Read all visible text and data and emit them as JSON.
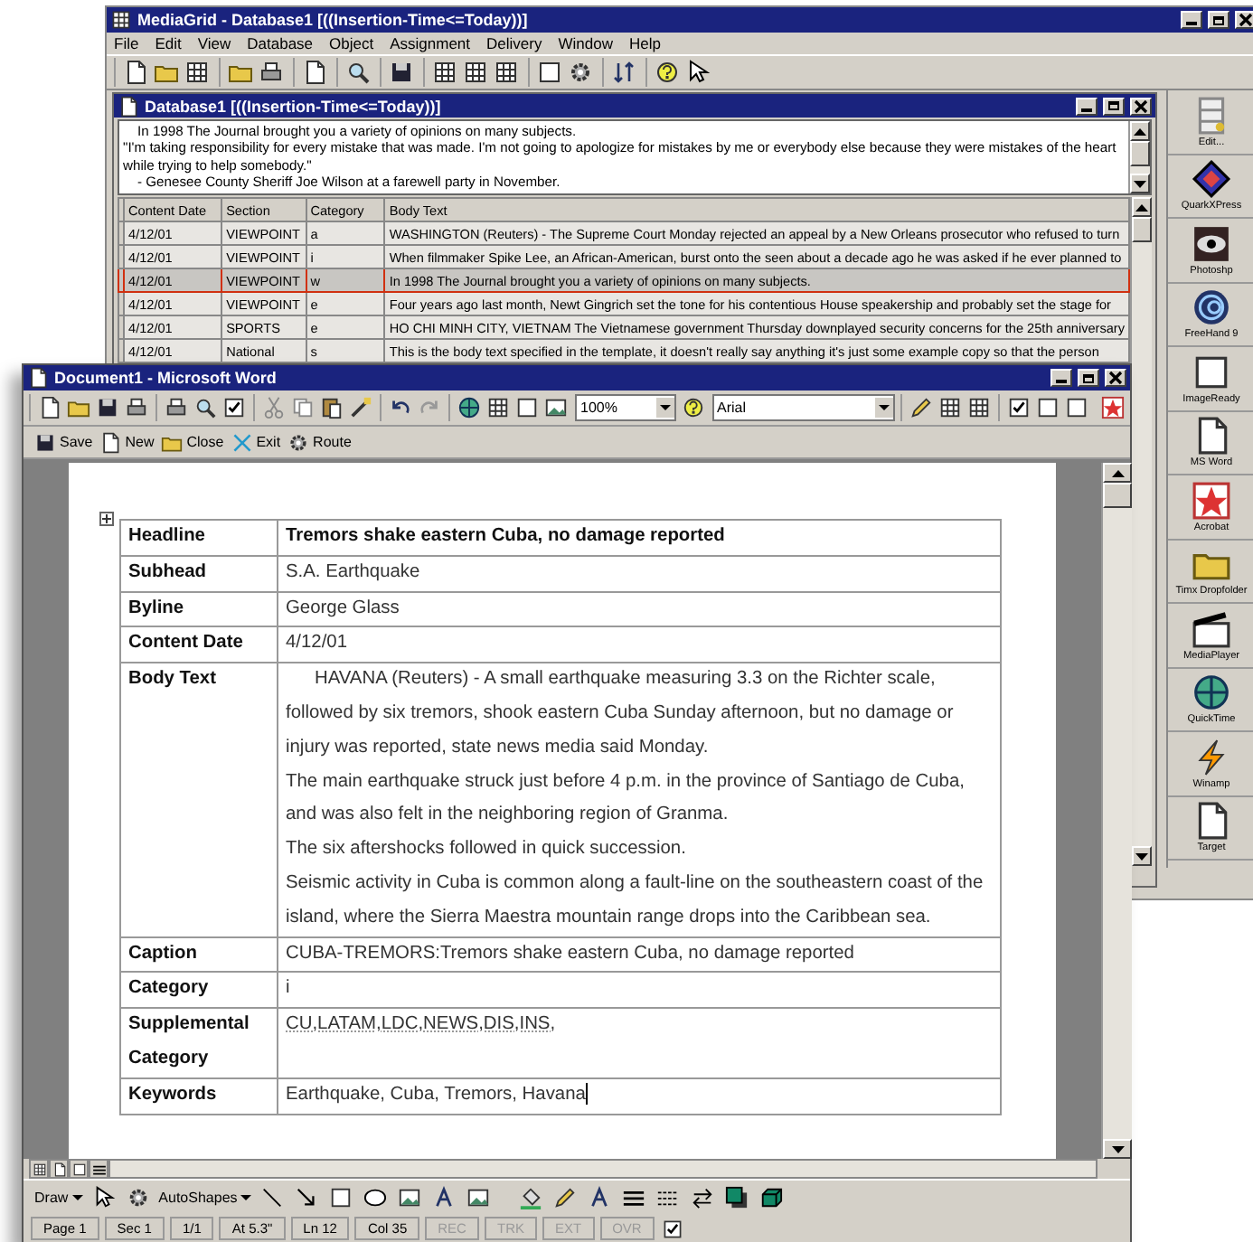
{
  "mediagrid_window": {
    "title": "MediaGrid - Database1 [((Insertion-Time<=Today))]",
    "menu": [
      "File",
      "Edit",
      "View",
      "Database",
      "Object",
      "Assignment",
      "Delivery",
      "Window",
      "Help"
    ]
  },
  "database_window": {
    "title": "Database1 [((Insertion-Time<=Today))]",
    "preview_lines": [
      "In 1998 The Journal brought you a variety of opinions on many subjects.",
      "\"I'm taking responsibility for every mistake that was made. I'm not going to apologize for mistakes by me or everybody else because they were mistakes of the heart",
      "while trying to help somebody.\"",
      "- Genesee County Sheriff Joe Wilson at a farewell party in November."
    ],
    "table": {
      "columns": [
        "Content Date",
        "Section",
        "Category",
        "Body Text"
      ],
      "rows": [
        {
          "cells": [
            "4/12/01",
            "VIEWPOINT",
            "a",
            "WASHINGTON (Reuters) - The Supreme Court Monday rejected an appeal by a New Orleans prosecutor who refused to turn"
          ],
          "selected": false
        },
        {
          "cells": [
            "4/12/01",
            "VIEWPOINT",
            "i",
            "When filmmaker Spike Lee, an African-American, burst onto the seen about a decade ago he was asked if he ever planned to"
          ],
          "selected": false
        },
        {
          "cells": [
            "4/12/01",
            "VIEWPOINT",
            "w",
            "In 1998 The Journal brought you a variety of opinions on many subjects."
          ],
          "selected": true
        },
        {
          "cells": [
            "4/12/01",
            "VIEWPOINT",
            "e",
            "Four years ago last month, Newt Gingrich set the tone for his contentious House speakership and probably set the stage for"
          ],
          "selected": false
        },
        {
          "cells": [
            "4/12/01",
            "SPORTS",
            "e",
            "HO CHI MINH CITY, VIETNAM  The Vietnamese government Thursday downplayed security concerns for the 25th anniversary"
          ],
          "selected": false
        },
        {
          "cells": [
            "4/12/01",
            "National",
            "s",
            "This is the body text specified in the template, it doesn't  really say anything it's just some example copy so that the person"
          ],
          "selected": false
        }
      ]
    }
  },
  "launcher": {
    "items": [
      {
        "label": "Edit..."
      },
      {
        "label": "QuarkXPress"
      },
      {
        "label": "Photoshp"
      },
      {
        "label": "FreeHand 9"
      },
      {
        "label": "ImageReady"
      },
      {
        "label": "MS Word"
      },
      {
        "label": "Acrobat"
      },
      {
        "label": "Timx Dropfolder"
      },
      {
        "label": "MediaPlayer"
      },
      {
        "label": "QuickTime"
      },
      {
        "label": "Winamp"
      },
      {
        "label": "Target"
      }
    ]
  },
  "word_window": {
    "title": "Document1 - Microsoft Word",
    "zoom": "100%",
    "font": "Arial",
    "custom_toolbar": [
      "Save",
      "New",
      "Close",
      "Exit",
      "Route"
    ],
    "document_table": [
      {
        "label": "Headline",
        "kind": "heading",
        "paragraphs": [
          "Tremors shake eastern Cuba, no damage reported"
        ]
      },
      {
        "label": "Subhead",
        "kind": "plain",
        "paragraphs": [
          "S.A. Earthquake"
        ]
      },
      {
        "label": "Byline",
        "kind": "plain",
        "paragraphs": [
          "George Glass"
        ]
      },
      {
        "label": "Content Date",
        "kind": "plain",
        "paragraphs": [
          "4/12/01"
        ]
      },
      {
        "label": "Body Text",
        "kind": "plain",
        "paragraphs": [
          "HAVANA (Reuters) - A small earthquake measuring 3.3 on the Richter scale, followed by six tremors, shook eastern Cuba Sunday afternoon, but no damage or injury was reported, state news media said Monday.",
          "The main earthquake struck just before 4 p.m. in the province of Santiago de Cuba, and was also felt in the neighboring region of Granma.",
          "The six aftershocks followed in quick succession.",
          "Seismic activity in Cuba is common along a fault-line on the southeastern coast of the island, where the Sierra Maestra mountain range drops into the Caribbean sea."
        ]
      },
      {
        "label": "Caption",
        "kind": "plain",
        "paragraphs": [
          "CUBA-TREMORS:Tremors shake eastern Cuba, no damage reported"
        ]
      },
      {
        "label": "Category",
        "kind": "plain",
        "paragraphs": [
          "i"
        ]
      },
      {
        "label": "Supplemental Category",
        "kind": "flagged",
        "paragraphs": [
          "CU,LATAM,LDC,NEWS,DIS,INS,"
        ]
      },
      {
        "label": "Keywords",
        "kind": "plain",
        "paragraphs": [
          "Earthquake, Cuba, Tremors,  Havana"
        ],
        "cursor": true
      }
    ],
    "draw_toolbar": {
      "draw_menu": "Draw",
      "autoshapes_menu": "AutoShapes"
    },
    "status_bar": [
      {
        "text": "Page 1",
        "disabled": false
      },
      {
        "text": "Sec 1",
        "disabled": false
      },
      {
        "text": "1/1",
        "disabled": false
      },
      {
        "text": "At 5.3\"",
        "disabled": false
      },
      {
        "text": "Ln 12",
        "disabled": false
      },
      {
        "text": "Col 35",
        "disabled": false
      },
      {
        "text": "REC",
        "disabled": true
      },
      {
        "text": "TRK",
        "disabled": true
      },
      {
        "text": "EXT",
        "disabled": true
      },
      {
        "text": "OVR",
        "disabled": true
      }
    ]
  }
}
